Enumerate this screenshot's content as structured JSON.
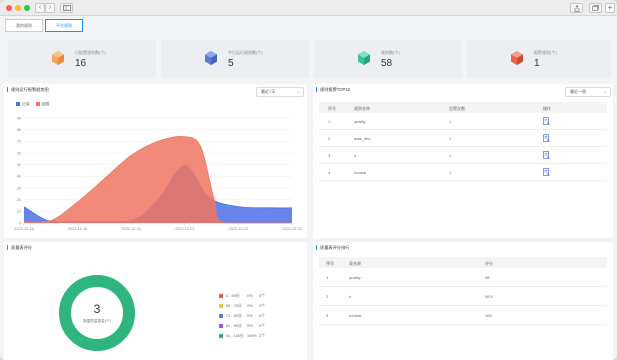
{
  "window": {
    "controls": [
      "close",
      "minimize",
      "zoom"
    ],
    "nav_back": "‹",
    "nav_forward": "›"
  },
  "tabs": [
    {
      "label": "我的规则",
      "active": false
    },
    {
      "label": "平台规则",
      "active": true
    }
  ],
  "stats": [
    {
      "label": "已配置规则数(个)",
      "value": "16",
      "color": "#f5a45a",
      "icon": "cube-orange-icon"
    },
    {
      "label": "今日运行规则数(个)",
      "value": "5",
      "color": "#5b7bd5",
      "icon": "cube-blue-icon"
    },
    {
      "label": "规则数(个)",
      "value": "58",
      "color": "#3cc49a",
      "icon": "cube-green-icon"
    },
    {
      "label": "报警规则(个)",
      "value": "1",
      "color": "#e8614c",
      "icon": "cube-red-icon"
    }
  ],
  "trend": {
    "title": "规则运行报警趋势图",
    "range_select": "最近7天",
    "legend": [
      {
        "name": "正常",
        "color": "#4c6ee6"
      },
      {
        "name": "报警",
        "color": "#f07562"
      }
    ]
  },
  "chart_data": {
    "type": "area",
    "x": [
      "2022-12-18",
      "2022-12-19",
      "2022-12-20",
      "2022-12-21",
      "2022-12-22",
      "2022-12-23"
    ],
    "ylim": [
      0,
      90
    ],
    "yticks": [
      0,
      10,
      20,
      30,
      40,
      50,
      60,
      70,
      80,
      90
    ],
    "series": [
      {
        "name": "正常",
        "color": "#4c6ee6",
        "points": [
          [
            0,
            14
          ],
          [
            0.45,
            2
          ],
          [
            1.0,
            1
          ],
          [
            2.0,
            2
          ],
          [
            2.5,
            20
          ],
          [
            3.0,
            49
          ],
          [
            3.45,
            22
          ],
          [
            4.0,
            14
          ],
          [
            4.6,
            13
          ],
          [
            5.0,
            13
          ]
        ]
      },
      {
        "name": "报警",
        "color": "#f07562",
        "points": [
          [
            0,
            1
          ],
          [
            0.5,
            2
          ],
          [
            1.0,
            18
          ],
          [
            1.5,
            38
          ],
          [
            2.0,
            58
          ],
          [
            2.5,
            70
          ],
          [
            3.0,
            74
          ],
          [
            3.3,
            65
          ],
          [
            3.55,
            20
          ],
          [
            3.75,
            0
          ],
          [
            5.0,
            0
          ]
        ]
      }
    ]
  },
  "top_rules": {
    "title": "规则报警TOP10",
    "range_select": "最近一周",
    "columns": [
      "序号",
      "规则名称",
      "告警次数",
      "操作"
    ],
    "rows": [
      {
        "index": "1",
        "name": "quality",
        "count": "1"
      },
      {
        "index": "2",
        "name": "data_dim",
        "count": "1"
      },
      {
        "index": "3",
        "name": "k",
        "count": "1"
      },
      {
        "index": "4",
        "name": "normal",
        "count": "1"
      }
    ]
  },
  "score_dist": {
    "title": "质量表评分",
    "center_value": "3",
    "center_label": "数据质量数量(个)",
    "legend": [
      {
        "label": "0 - 59分",
        "pct": "0%",
        "count": "0个",
        "color": "#e8614c"
      },
      {
        "label": "60 - 70分",
        "pct": "0%",
        "count": "0个",
        "color": "#f5c342"
      },
      {
        "label": "71 - 80分",
        "pct": "0%",
        "count": "0个",
        "color": "#5b7bd5"
      },
      {
        "label": "81 - 90分",
        "pct": "0%",
        "count": "0个",
        "color": "#8e5fd6"
      },
      {
        "label": "91 - 100分",
        "pct": "100%",
        "count": "3个",
        "color": "#2fb57e"
      }
    ]
  },
  "score_rank": {
    "title": "质量表评分排行",
    "columns": [
      "序号",
      "表名称",
      "评分"
    ],
    "rows": [
      {
        "index": "1",
        "name": "quality",
        "score": "98"
      },
      {
        "index": "2",
        "name": "k",
        "score": "98.5"
      },
      {
        "index": "3",
        "name": "normal",
        "score": "100"
      }
    ]
  }
}
